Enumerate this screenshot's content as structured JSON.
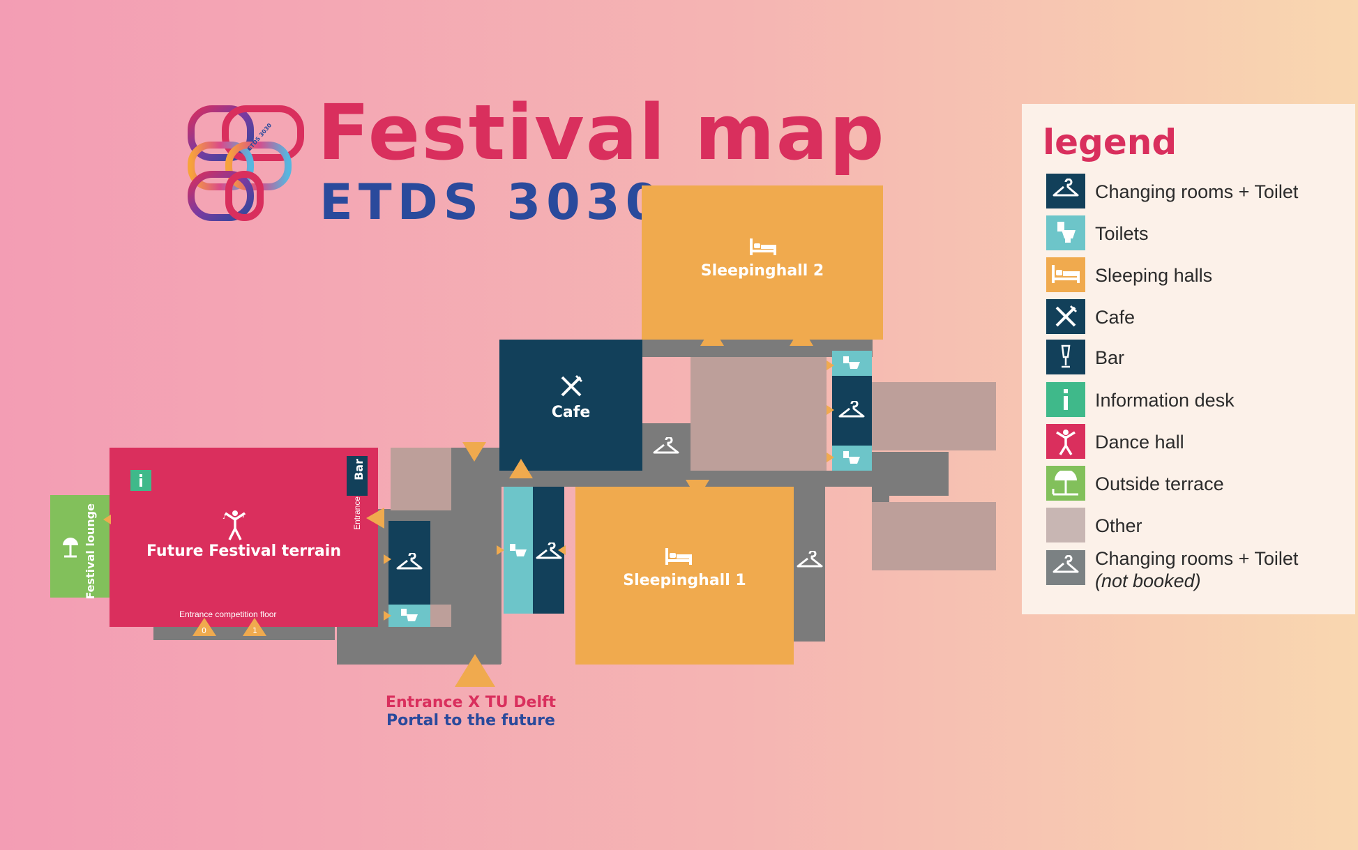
{
  "header": {
    "title": "Festival map",
    "subtitle": "ETDS 3030",
    "logo_text": "ETDS 3030"
  },
  "rooms": {
    "cafe": "Cafe",
    "sleepinghall_1": "Sleepinghall 1",
    "sleepinghall_2": "Sleepinghall 2",
    "future_festival_terrain": "Future Festival terrain",
    "festival_lounge": "Festival lounge",
    "bar": "Bar",
    "side_entrance": "Entrance",
    "entrance_competition_floor": "Entrance competition floor",
    "stair_0": "0",
    "stair_1": "1"
  },
  "main_entrance": {
    "line1": "Entrance X TU Delft",
    "line2": "Portal to the future",
    "line1_color": "#d92f5d",
    "line2_color": "#2a4a9c"
  },
  "legend": {
    "title": "legend",
    "items": [
      {
        "label": "Changing rooms + Toilet",
        "icon": "hanger-icon",
        "color": "#12405a"
      },
      {
        "label": "Toilets",
        "icon": "toilet-icon",
        "color": "#6dc5c9"
      },
      {
        "label": "Sleeping halls",
        "icon": "bed-icon",
        "color": "#f0aa4e"
      },
      {
        "label": "Cafe",
        "icon": "fork-knife-icon",
        "color": "#12405a"
      },
      {
        "label": "Bar",
        "icon": "drink-icon",
        "color": "#12405a"
      },
      {
        "label": "Information desk",
        "icon": "info-icon",
        "color": "#3fb98a"
      },
      {
        "label": "Dance hall",
        "icon": "dancer-icon",
        "color": "#da2f5d"
      },
      {
        "label": "Outside terrace",
        "icon": "umbrella-icon",
        "color": "#82c05b"
      },
      {
        "label": "Other",
        "icon": "",
        "color": "#c8b6b3"
      },
      {
        "label": "Changing rooms + Toilet",
        "note": "(not booked)",
        "icon": "hanger-icon",
        "color": "#7b8183"
      }
    ]
  },
  "colors": {
    "corridor": "#7b7b7b",
    "other": "#bd9f9a",
    "navy": "#12405a",
    "teal": "#6dc5c9",
    "orange": "#f0aa4e",
    "magenta": "#da2f5d",
    "green": "#82c05b"
  }
}
